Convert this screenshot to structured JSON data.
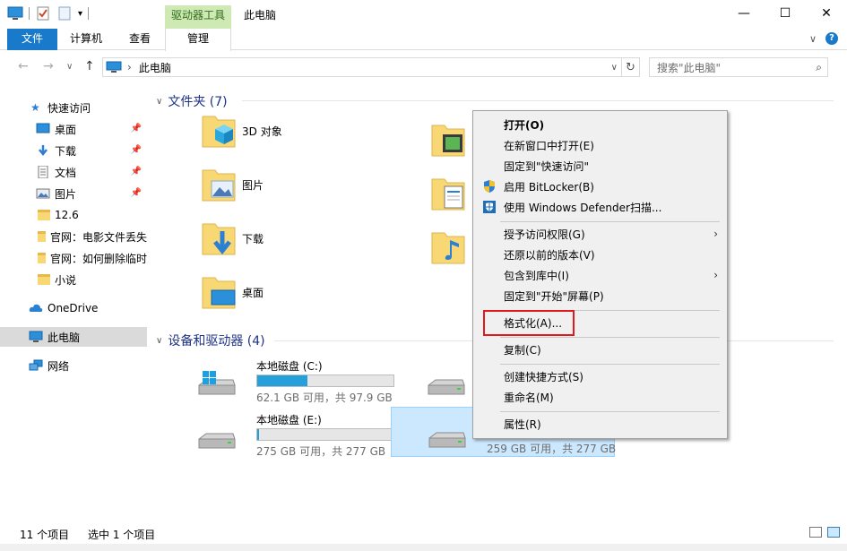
{
  "window": {
    "title": "此电脑",
    "context_tab_title": "驱动器工具",
    "minimize": "—",
    "maximize": "☐",
    "close": "✕"
  },
  "ribbon": {
    "tabs": [
      {
        "label": "文件"
      },
      {
        "label": "计算机"
      },
      {
        "label": "查看"
      },
      {
        "label": "管理"
      }
    ],
    "collapse": "∨",
    "help": "?"
  },
  "address": {
    "back": "←",
    "forward": "→",
    "recent": "∨",
    "up": "↑",
    "path": "此电脑",
    "crumb_sep": "›",
    "dropdown": "∨",
    "refresh": "↻",
    "search_placeholder": "搜索\"此电脑\"",
    "search_icon": "⌕"
  },
  "sidebar": {
    "items": [
      {
        "label": "快速访问",
        "icon": "star-icon"
      },
      {
        "label": "桌面",
        "icon": "desktop-icon",
        "pinned": true
      },
      {
        "label": "下载",
        "icon": "download-icon",
        "pinned": true
      },
      {
        "label": "文档",
        "icon": "document-icon",
        "pinned": true
      },
      {
        "label": "图片",
        "icon": "picture-icon",
        "pinned": true
      },
      {
        "label": "12.6",
        "icon": "folder-icon"
      },
      {
        "label": "官网：电影文件丢失",
        "icon": "folder-icon"
      },
      {
        "label": "官网：如何删除临时",
        "icon": "folder-icon"
      },
      {
        "label": "小说",
        "icon": "folder-icon"
      },
      {
        "label": "OneDrive",
        "icon": "cloud-icon"
      },
      {
        "label": "此电脑",
        "icon": "computer-icon"
      },
      {
        "label": "网络",
        "icon": "network-icon"
      }
    ],
    "pin_glyph": "📌"
  },
  "content": {
    "folders_header": "文件夹 (7)",
    "devices_header": "设备和驱动器 (4)",
    "group_chevron": "∨",
    "folders": [
      {
        "label": "3D 对象"
      },
      {
        "label": "图片"
      },
      {
        "label": "下载"
      },
      {
        "label": "桌面"
      }
    ],
    "drives": [
      {
        "name": "本地磁盘 (C:)",
        "info": "62.1 GB 可用，共 97.9 GB",
        "used_fraction": 0.366
      },
      {
        "name": "本地磁盘 (E:)",
        "info": "275 GB 可用，共 277 GB",
        "used_fraction": 0.007
      },
      {
        "name": "",
        "info": "259 GB 可用，共 277 GB",
        "used_fraction": 0.065
      }
    ]
  },
  "context_menu": {
    "items": [
      {
        "label": "打开(O)"
      },
      {
        "label": "在新窗口中打开(E)"
      },
      {
        "label": "固定到\"快速访问\""
      },
      {
        "label": "启用 BitLocker(B)"
      },
      {
        "label": "使用 Windows Defender扫描..."
      },
      {
        "label": "授予访问权限(G)"
      },
      {
        "label": "还原以前的版本(V)"
      },
      {
        "label": "包含到库中(I)"
      },
      {
        "label": "固定到\"开始\"屏幕(P)"
      },
      {
        "label": "格式化(A)..."
      },
      {
        "label": "复制(C)"
      },
      {
        "label": "创建快捷方式(S)"
      },
      {
        "label": "重命名(M)"
      },
      {
        "label": "属性(R)"
      }
    ],
    "submenu_arrow": "›"
  },
  "status": {
    "item_count": "11 个项目",
    "selected": "选中 1 个项目"
  }
}
